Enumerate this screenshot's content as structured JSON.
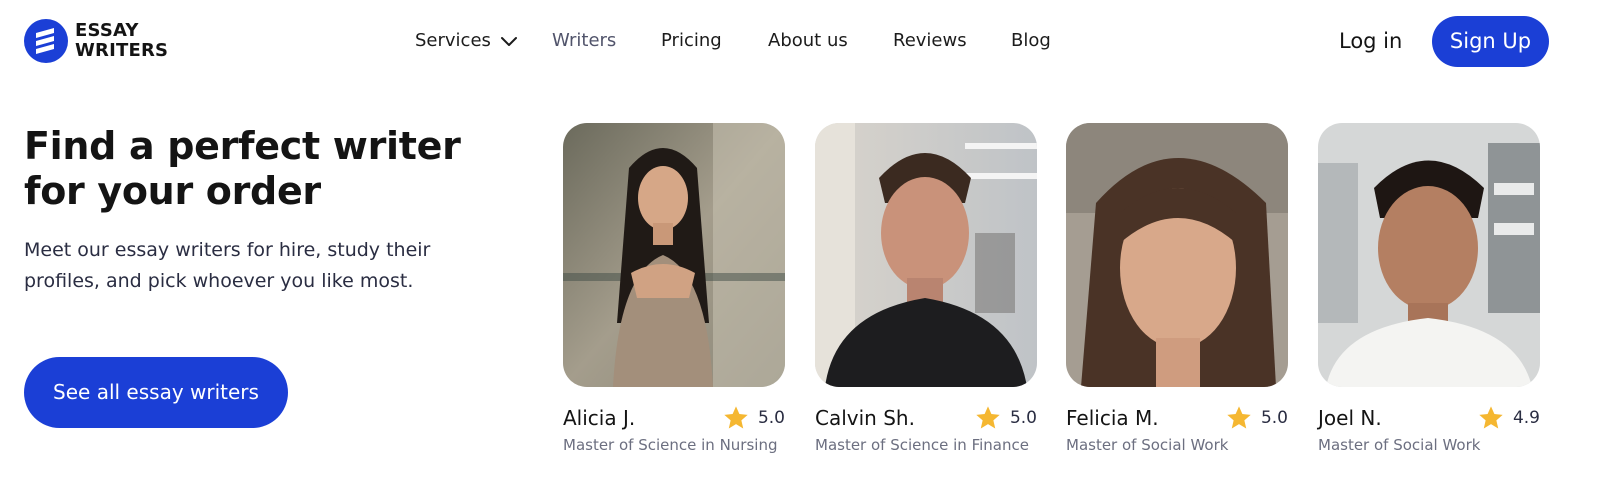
{
  "brand": {
    "line1": "ESSAY",
    "line2": "WRITERS",
    "color": "#1b3fd6"
  },
  "nav": {
    "services": "Services",
    "writers": "Writers",
    "pricing": "Pricing",
    "about": "About us",
    "reviews": "Reviews",
    "blog": "Blog"
  },
  "auth": {
    "login": "Log in",
    "signup": "Sign Up"
  },
  "hero": {
    "title": "Find a perfect writer for your order",
    "subtitle": "Meet our essay writers for hire, study their profiles, and pick whoever you like most.",
    "cta": "See all essay writers"
  },
  "writers": [
    {
      "name": "Alicia J.",
      "rating": "5.0",
      "degree": "Master of Science in Nursing",
      "icon": "star-icon"
    },
    {
      "name": "Calvin Sh.",
      "rating": "5.0",
      "degree": "Master of Science in Finance",
      "icon": "star-icon"
    },
    {
      "name": "Felicia M.",
      "rating": "5.0",
      "degree": "Master of Social Work",
      "icon": "star-icon"
    },
    {
      "name": "Joel N.",
      "rating": "4.9",
      "degree": "Master of Social Work",
      "icon": "star-icon"
    }
  ],
  "colors": {
    "accent": "#1b3fd6",
    "star": "#f5b731",
    "text": "#141414",
    "muted": "#6c6f80"
  }
}
